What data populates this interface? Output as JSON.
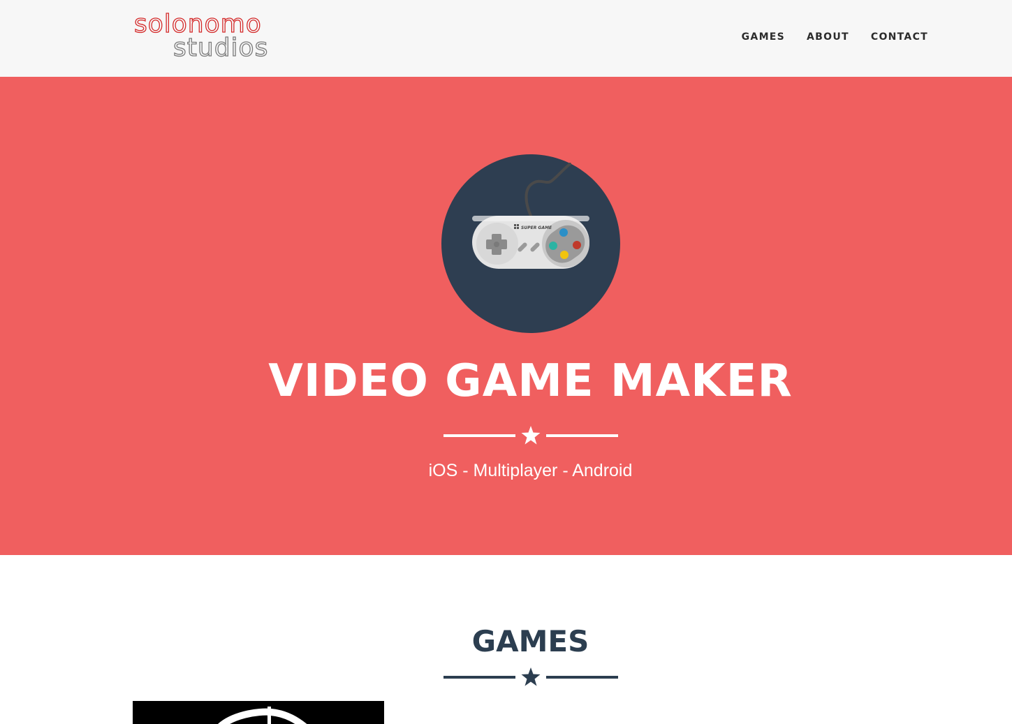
{
  "logo": {
    "line1": "solonomo",
    "line2": "studios",
    "line1_color": "#d42a2a",
    "line2_color": "#7a7a7a"
  },
  "nav": {
    "items": [
      {
        "label": "GAMES"
      },
      {
        "label": "ABOUT"
      },
      {
        "label": "CONTACT"
      }
    ]
  },
  "hero": {
    "background": "#f05f5f",
    "icon": "game-controller-icon",
    "controller_brand": "SUPER GAME",
    "title": "VIDEO GAME MAKER",
    "divider_icon": "star-icon",
    "subtitle": "iOS - Multiplayer - Android"
  },
  "games": {
    "title": "GAMES",
    "divider_icon": "star-icon",
    "accent_color": "#2c3e50"
  }
}
